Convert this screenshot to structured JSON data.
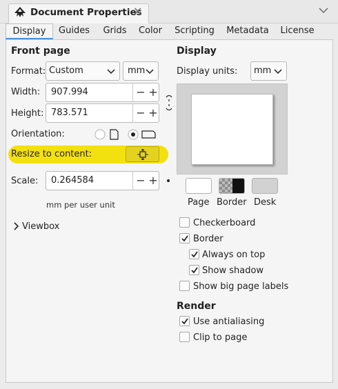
{
  "window": {
    "title": "Document Properties",
    "close_symbol": "✕"
  },
  "tabs": [
    "Display",
    "Guides",
    "Grids",
    "Color",
    "Scripting",
    "Metadata",
    "License"
  ],
  "active_tab": "Display",
  "front_page": {
    "heading": "Front page",
    "format_label": "Format:",
    "format_value": "Custom",
    "unit_value": "mm",
    "width_label": "Width:",
    "width_value": "907.994",
    "height_label": "Height:",
    "height_value": "783.571",
    "orientation_label": "Orientation:",
    "resize_label": "Resize to content:",
    "scale_label": "Scale:",
    "scale_value": "0.264584",
    "scale_unit_note": "mm per user unit",
    "viewbox_label": "Viewbox",
    "minus_symbol": "−",
    "plus_symbol": "+"
  },
  "display": {
    "heading": "Display",
    "units_label": "Display units:",
    "units_value": "mm",
    "swatches": [
      {
        "label": "Page"
      },
      {
        "label": "Border"
      },
      {
        "label": "Desk"
      }
    ],
    "checkboxes": {
      "checkerboard": {
        "label": "Checkerboard",
        "checked": false
      },
      "border": {
        "label": "Border",
        "checked": true
      },
      "always_on_top": {
        "label": "Always on top",
        "checked": true
      },
      "show_shadow": {
        "label": "Show shadow",
        "checked": true
      },
      "big_page_labels": {
        "label": "Show big page labels",
        "checked": false
      }
    }
  },
  "render": {
    "heading": "Render",
    "antialiasing": {
      "label": "Use antialiasing",
      "checked": true
    },
    "clip_to_page": {
      "label": "Clip to page",
      "checked": false
    }
  },
  "colors": {
    "highlight": "#f3e00f",
    "tab_underline": "#4a90d9"
  }
}
